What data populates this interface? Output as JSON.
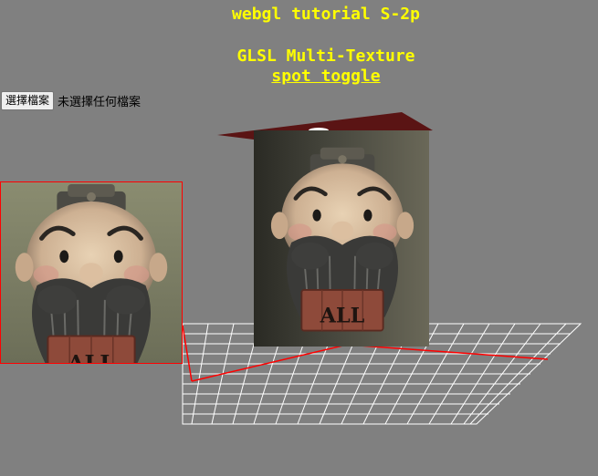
{
  "header": {
    "title": "webgl tutorial S-2p",
    "subtitle": "GLSL Multi-Texture",
    "toggle_link": "spot toggle"
  },
  "file_input": {
    "button_label": "選擇檔案",
    "status_text": "未選擇任何檔案"
  },
  "colors": {
    "background": "#808080",
    "title": "#ffff00",
    "grid": "#ffffff",
    "axis": "#ff0000",
    "ceiling": "#5a1414",
    "thumbnail_border": "#ff0000"
  },
  "scene": {
    "ceiling_light_icon": "spotlight-icon",
    "textured_panel_subject": "bearded figurine holding a sign",
    "sign_text": "ALL"
  }
}
